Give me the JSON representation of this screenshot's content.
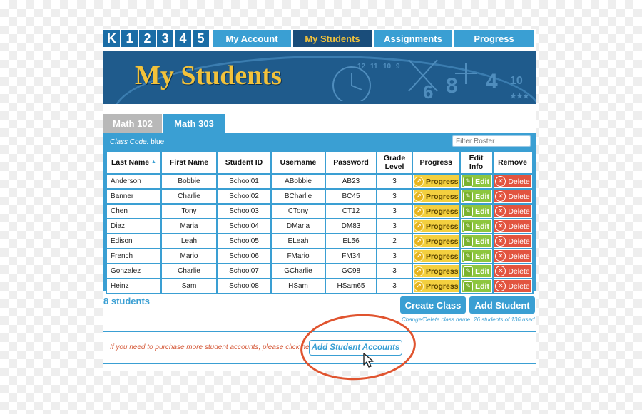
{
  "nav": {
    "logo_letters": [
      "K",
      "1",
      "2",
      "3",
      "4",
      "5"
    ],
    "tabs": [
      {
        "label": "My Account",
        "active": false
      },
      {
        "label": "My Students",
        "active": true
      },
      {
        "label": "Assignments",
        "active": false
      },
      {
        "label": "Progress",
        "active": false
      }
    ]
  },
  "banner": {
    "title": "My Students",
    "decor_numbers": [
      "12",
      "11",
      "10",
      "9"
    ]
  },
  "class_tabs": [
    {
      "label": "Math 102",
      "active": false
    },
    {
      "label": "Math 303",
      "active": true
    }
  ],
  "roster": {
    "class_code_label": "Class Code:",
    "class_code_value": "blue",
    "filter_placeholder": "Filter Roster",
    "columns": [
      "Last Name",
      "First Name",
      "Student ID",
      "Username",
      "Password",
      "Grade Level",
      "Progress",
      "Edit Info",
      "Remove"
    ],
    "columns_grade_line1": "Grade",
    "columns_grade_line2": "Level",
    "sort_indicator": "▲",
    "progress_label": "Progress",
    "edit_label": "Edit",
    "delete_label": "Delete",
    "rows": [
      [
        "Anderson",
        "Bobbie",
        "School01",
        "ABobbie",
        "AB23",
        "3"
      ],
      [
        "Banner",
        "Charlie",
        "School02",
        "BCharlie",
        "BC45",
        "3"
      ],
      [
        "Chen",
        "Tony",
        "School03",
        "CTony",
        "CT12",
        "3"
      ],
      [
        "Diaz",
        "Maria",
        "School04",
        "DMaria",
        "DM83",
        "3"
      ],
      [
        "Edison",
        "Leah",
        "School05",
        "ELeah",
        "EL56",
        "2"
      ],
      [
        "French",
        "Mario",
        "School06",
        "FMario",
        "FM34",
        "3"
      ],
      [
        "Gonzalez",
        "Charlie",
        "School07",
        "GCharlie",
        "GC98",
        "3"
      ],
      [
        "Heinz",
        "Sam",
        "School08",
        "HSam",
        "HSam65",
        "3"
      ]
    ]
  },
  "footer": {
    "student_count": "8 students",
    "create_class_label": "Create Class",
    "add_student_label": "Add Student",
    "create_note": "Change/Delete class name",
    "usage_note": "26 students of 136 used",
    "purchase_text": "If you need to purchase more student accounts, please click here",
    "add_accounts_label": "Add Student Accounts"
  },
  "colors": {
    "primary": "#3a9fd3",
    "nav_active": "#1a4d7a",
    "gold": "#f2c23b",
    "progress": "#f4d03f",
    "edit": "#8dc63f",
    "delete": "#e2543f",
    "highlight": "#e0542f"
  },
  "icons": [
    "progress-chart-icon",
    "edit-pencil-icon",
    "delete-x-icon",
    "sort-up-icon",
    "mouse-pointer-icon",
    "clock-icon"
  ]
}
